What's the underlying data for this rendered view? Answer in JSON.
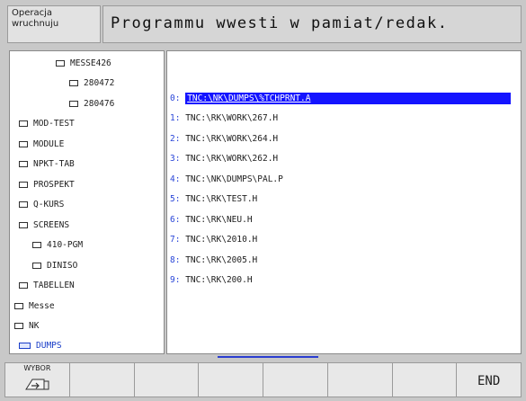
{
  "header": {
    "mode_line1": "Operacja",
    "mode_line2": "wruchnuju",
    "title": "Programmu wwesti w pamiat/redak."
  },
  "tree": [
    {
      "label": "MESSE426",
      "state": "closed"
    },
    {
      "label": "280472",
      "state": "closed"
    },
    {
      "label": "280476",
      "state": "closed"
    },
    {
      "label": "MOD-TEST",
      "state": "closed"
    },
    {
      "label": "MODULE",
      "state": "closed"
    },
    {
      "label": "NPKT-TAB",
      "state": "closed"
    },
    {
      "label": "PROSPEKT",
      "state": "closed"
    },
    {
      "label": "Q-KURS",
      "state": "closed"
    },
    {
      "label": "SCREENS",
      "state": "closed"
    },
    {
      "label": "410-PGM",
      "state": "closed"
    },
    {
      "label": "DINISO",
      "state": "closed"
    },
    {
      "label": "TABELLEN",
      "state": "closed"
    },
    {
      "label": "Messe",
      "state": "closed"
    },
    {
      "label": "NK",
      "state": "closed"
    },
    {
      "label": "DUMPS",
      "state": "open-selected"
    }
  ],
  "files": [
    {
      "index": "0:",
      "path": "TNC:\\NK\\DUMPS\\%TCHPRNT.A",
      "selected": true
    },
    {
      "index": "1:",
      "path": "TNC:\\RK\\WORK\\267.H"
    },
    {
      "index": "2:",
      "path": "TNC:\\RK\\WORK\\264.H"
    },
    {
      "index": "3:",
      "path": "TNC:\\RK\\WORK\\262.H"
    },
    {
      "index": "4:",
      "path": "TNC:\\NK\\DUMPS\\PAL.P"
    },
    {
      "index": "5:",
      "path": "TNC:\\RK\\TEST.H"
    },
    {
      "index": "6:",
      "path": "TNC:\\RK\\NEU.H"
    },
    {
      "index": "7:",
      "path": "TNC:\\RK\\2010.H"
    },
    {
      "index": "8:",
      "path": "TNC:\\RK\\2005.H"
    },
    {
      "index": "9:",
      "path": "TNC:\\RK\\200.H"
    }
  ],
  "softkeys": {
    "select_label": "WYBOR",
    "select_icon": "enter-hand-icon",
    "end_label": "END"
  },
  "colors": {
    "selection": "#1414ff",
    "index": "#2a46d8",
    "selected_folder": "#1a3ec8"
  }
}
